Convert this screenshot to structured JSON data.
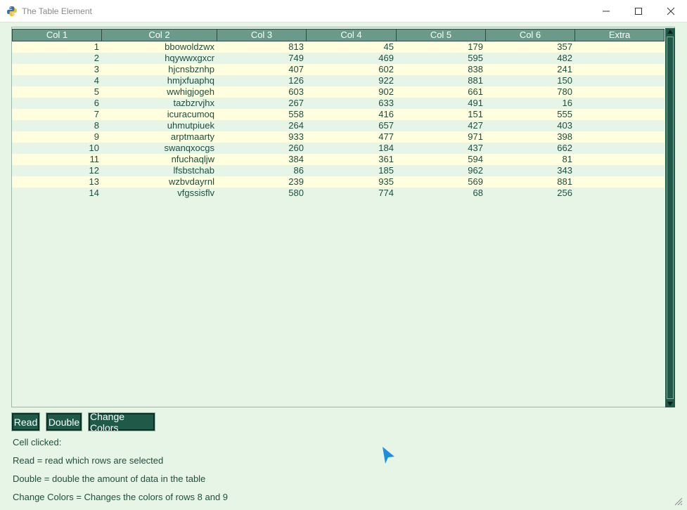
{
  "window": {
    "title": "The Table Element",
    "minimize": "—",
    "maximize": "☐",
    "close": "✕"
  },
  "table": {
    "headers": [
      "Col 1",
      "Col 2",
      "Col 3",
      "Col 4",
      "Col 5",
      "Col 6",
      "Extra"
    ],
    "rows": [
      [
        "1",
        "bbowoldzwx",
        "813",
        "45",
        "179",
        "357",
        ""
      ],
      [
        "2",
        "hqywwxgxcr",
        "749",
        "469",
        "595",
        "482",
        ""
      ],
      [
        "3",
        "hjcnsbznhp",
        "407",
        "602",
        "838",
        "241",
        ""
      ],
      [
        "4",
        "hmjxfuaphq",
        "126",
        "922",
        "881",
        "150",
        ""
      ],
      [
        "5",
        "wwhigjogeh",
        "603",
        "902",
        "661",
        "780",
        ""
      ],
      [
        "6",
        "tazbzrvjhx",
        "267",
        "633",
        "491",
        "16",
        ""
      ],
      [
        "7",
        "icuracumoq",
        "558",
        "416",
        "151",
        "555",
        ""
      ],
      [
        "8",
        "uhmutpiuek",
        "264",
        "657",
        "427",
        "403",
        ""
      ],
      [
        "9",
        "arptmaarty",
        "933",
        "477",
        "971",
        "398",
        ""
      ],
      [
        "10",
        "swanqxocgs",
        "260",
        "184",
        "437",
        "662",
        ""
      ],
      [
        "11",
        "nfuchaqljw",
        "384",
        "361",
        "594",
        "81",
        ""
      ],
      [
        "12",
        "lfsbstchab",
        "86",
        "185",
        "962",
        "343",
        ""
      ],
      [
        "13",
        "wzbvdayrnl",
        "239",
        "935",
        "569",
        "881",
        ""
      ],
      [
        "14",
        "vfgssisflv",
        "580",
        "774",
        "68",
        "256",
        ""
      ]
    ]
  },
  "buttons": {
    "read": "Read",
    "double": "Double",
    "change_colors": "Change Colors"
  },
  "info": {
    "cell_clicked": "Cell clicked:",
    "read_desc": "Read = read which rows are selected",
    "double_desc": "Double = double the amount of data in the table",
    "colors_desc": "Change Colors = Changes the colors of rows 8 and 9"
  },
  "colors": {
    "background": "#e6f5e6",
    "header": "#6b9a8a",
    "row_alt": "#ffffe0",
    "button": "#1f5a48",
    "text": "#1f4e3d"
  }
}
